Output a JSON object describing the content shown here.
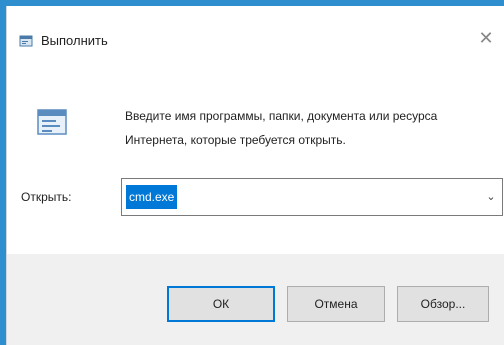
{
  "dialog": {
    "title": "Выполнить",
    "description": "Введите имя программы, папки, документа или ресурса Интернета, которые требуется открыть.",
    "open_label": "Открыть:",
    "input_value": "cmd.exe",
    "buttons": {
      "ok": "ОК",
      "cancel": "Отмена",
      "browse": "Обзор..."
    }
  },
  "icons": {
    "title": "run-app-icon",
    "close": "close-icon",
    "run": "run-dialog-icon",
    "dropdown": "chevron-down-icon"
  },
  "colors": {
    "accent": "#0078d7",
    "background": "#2f8fce",
    "footer": "#f0f0f0"
  }
}
